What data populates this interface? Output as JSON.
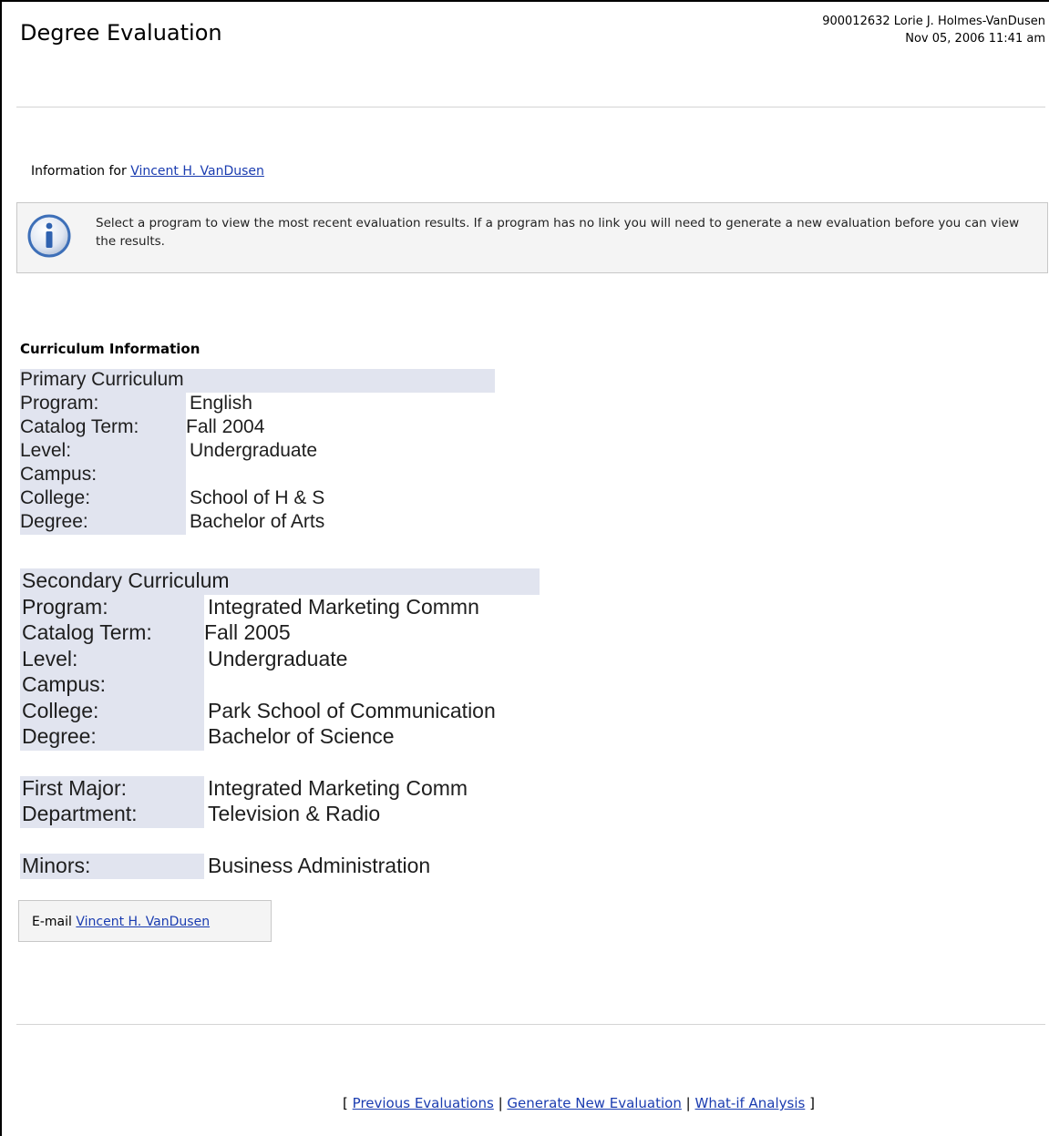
{
  "header": {
    "title": "Degree Evaluation",
    "user_line": "900012632 Lorie J. Holmes-VanDusen",
    "datetime": "Nov 05, 2006 11:41 am"
  },
  "info": {
    "prefix": "Information for",
    "student_name": "Vincent H. VanDusen"
  },
  "notice": {
    "icon": "info-icon",
    "text": "Select a program to view the most recent evaluation results. If a program has no link you will need to generate a new evaluation before you can view the results."
  },
  "curriculum": {
    "title": "Curriculum Information",
    "primary": {
      "heading": "Primary Curriculum",
      "rows": [
        {
          "label": "Program:",
          "value": "English"
        },
        {
          "label": "Catalog Term:",
          "value": "Fall 2004"
        },
        {
          "label": "Level:",
          "value": "Undergraduate"
        },
        {
          "label": "Campus:",
          "value": ""
        },
        {
          "label": "College:",
          "value": "School of H & S"
        },
        {
          "label": "Degree:",
          "value": "Bachelor of Arts"
        }
      ]
    },
    "secondary": {
      "heading": "Secondary Curriculum",
      "rows": [
        {
          "label": "Program:",
          "value": "Integrated Marketing Commn"
        },
        {
          "label": "Catalog Term:",
          "value": "Fall 2005"
        },
        {
          "label": "Level:",
          "value": "Undergraduate"
        },
        {
          "label": "Campus:",
          "value": ""
        },
        {
          "label": "College:",
          "value": "Park School of Communication"
        },
        {
          "label": "Degree:",
          "value": "Bachelor of Science"
        }
      ],
      "major_rows": [
        {
          "label": "First Major:",
          "value": "Integrated Marketing Comm"
        },
        {
          "label": "Department:",
          "value": "Television & Radio"
        }
      ],
      "minor_rows": [
        {
          "label": "Minors:",
          "value": "Business Administration"
        }
      ]
    }
  },
  "email": {
    "prefix": "E-mail",
    "name": "Vincent H. VanDusen"
  },
  "footer": {
    "open_bracket": "[",
    "close_bracket": "]",
    "separator": "|",
    "links": [
      "Previous Evaluations",
      "Generate New Evaluation",
      "What-if Analysis"
    ]
  }
}
